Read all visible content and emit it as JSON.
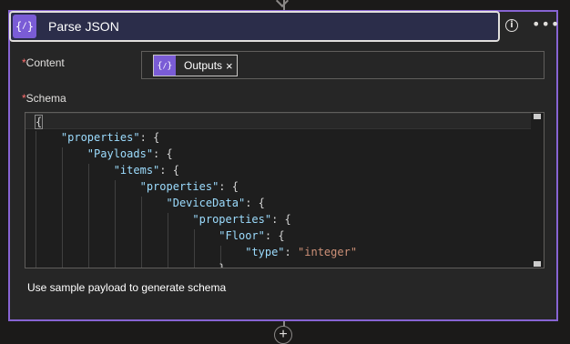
{
  "action": {
    "icon": "expression-icon",
    "title": "Parse JSON"
  },
  "header_icons": {
    "info": "i",
    "more": "•••"
  },
  "content_field": {
    "required_mark": "*",
    "label": "Content",
    "token": {
      "icon": "expression-icon",
      "label": "Outputs",
      "remove": "×"
    }
  },
  "schema_field": {
    "required_mark": "*",
    "label": "Schema",
    "code_lines": [
      "{",
      "    \"properties\": {",
      "        \"Payloads\": {",
      "            \"items\": {",
      "                \"properties\": {",
      "                    \"DeviceData\": {",
      "                        \"properties\": {",
      "                            \"Floor\": {",
      "                                \"type\": \"integer\"",
      "                            }"
    ]
  },
  "sample_payload_link": "Use sample payload to generate schema",
  "add_step": "+",
  "colors": {
    "accent": "#8764d3",
    "header_bg": "#2b2d4a",
    "icon_bg": "#7a5cd6",
    "json_key": "#9cdcfe",
    "json_string": "#ce9178",
    "required": "#ff6f6f"
  }
}
